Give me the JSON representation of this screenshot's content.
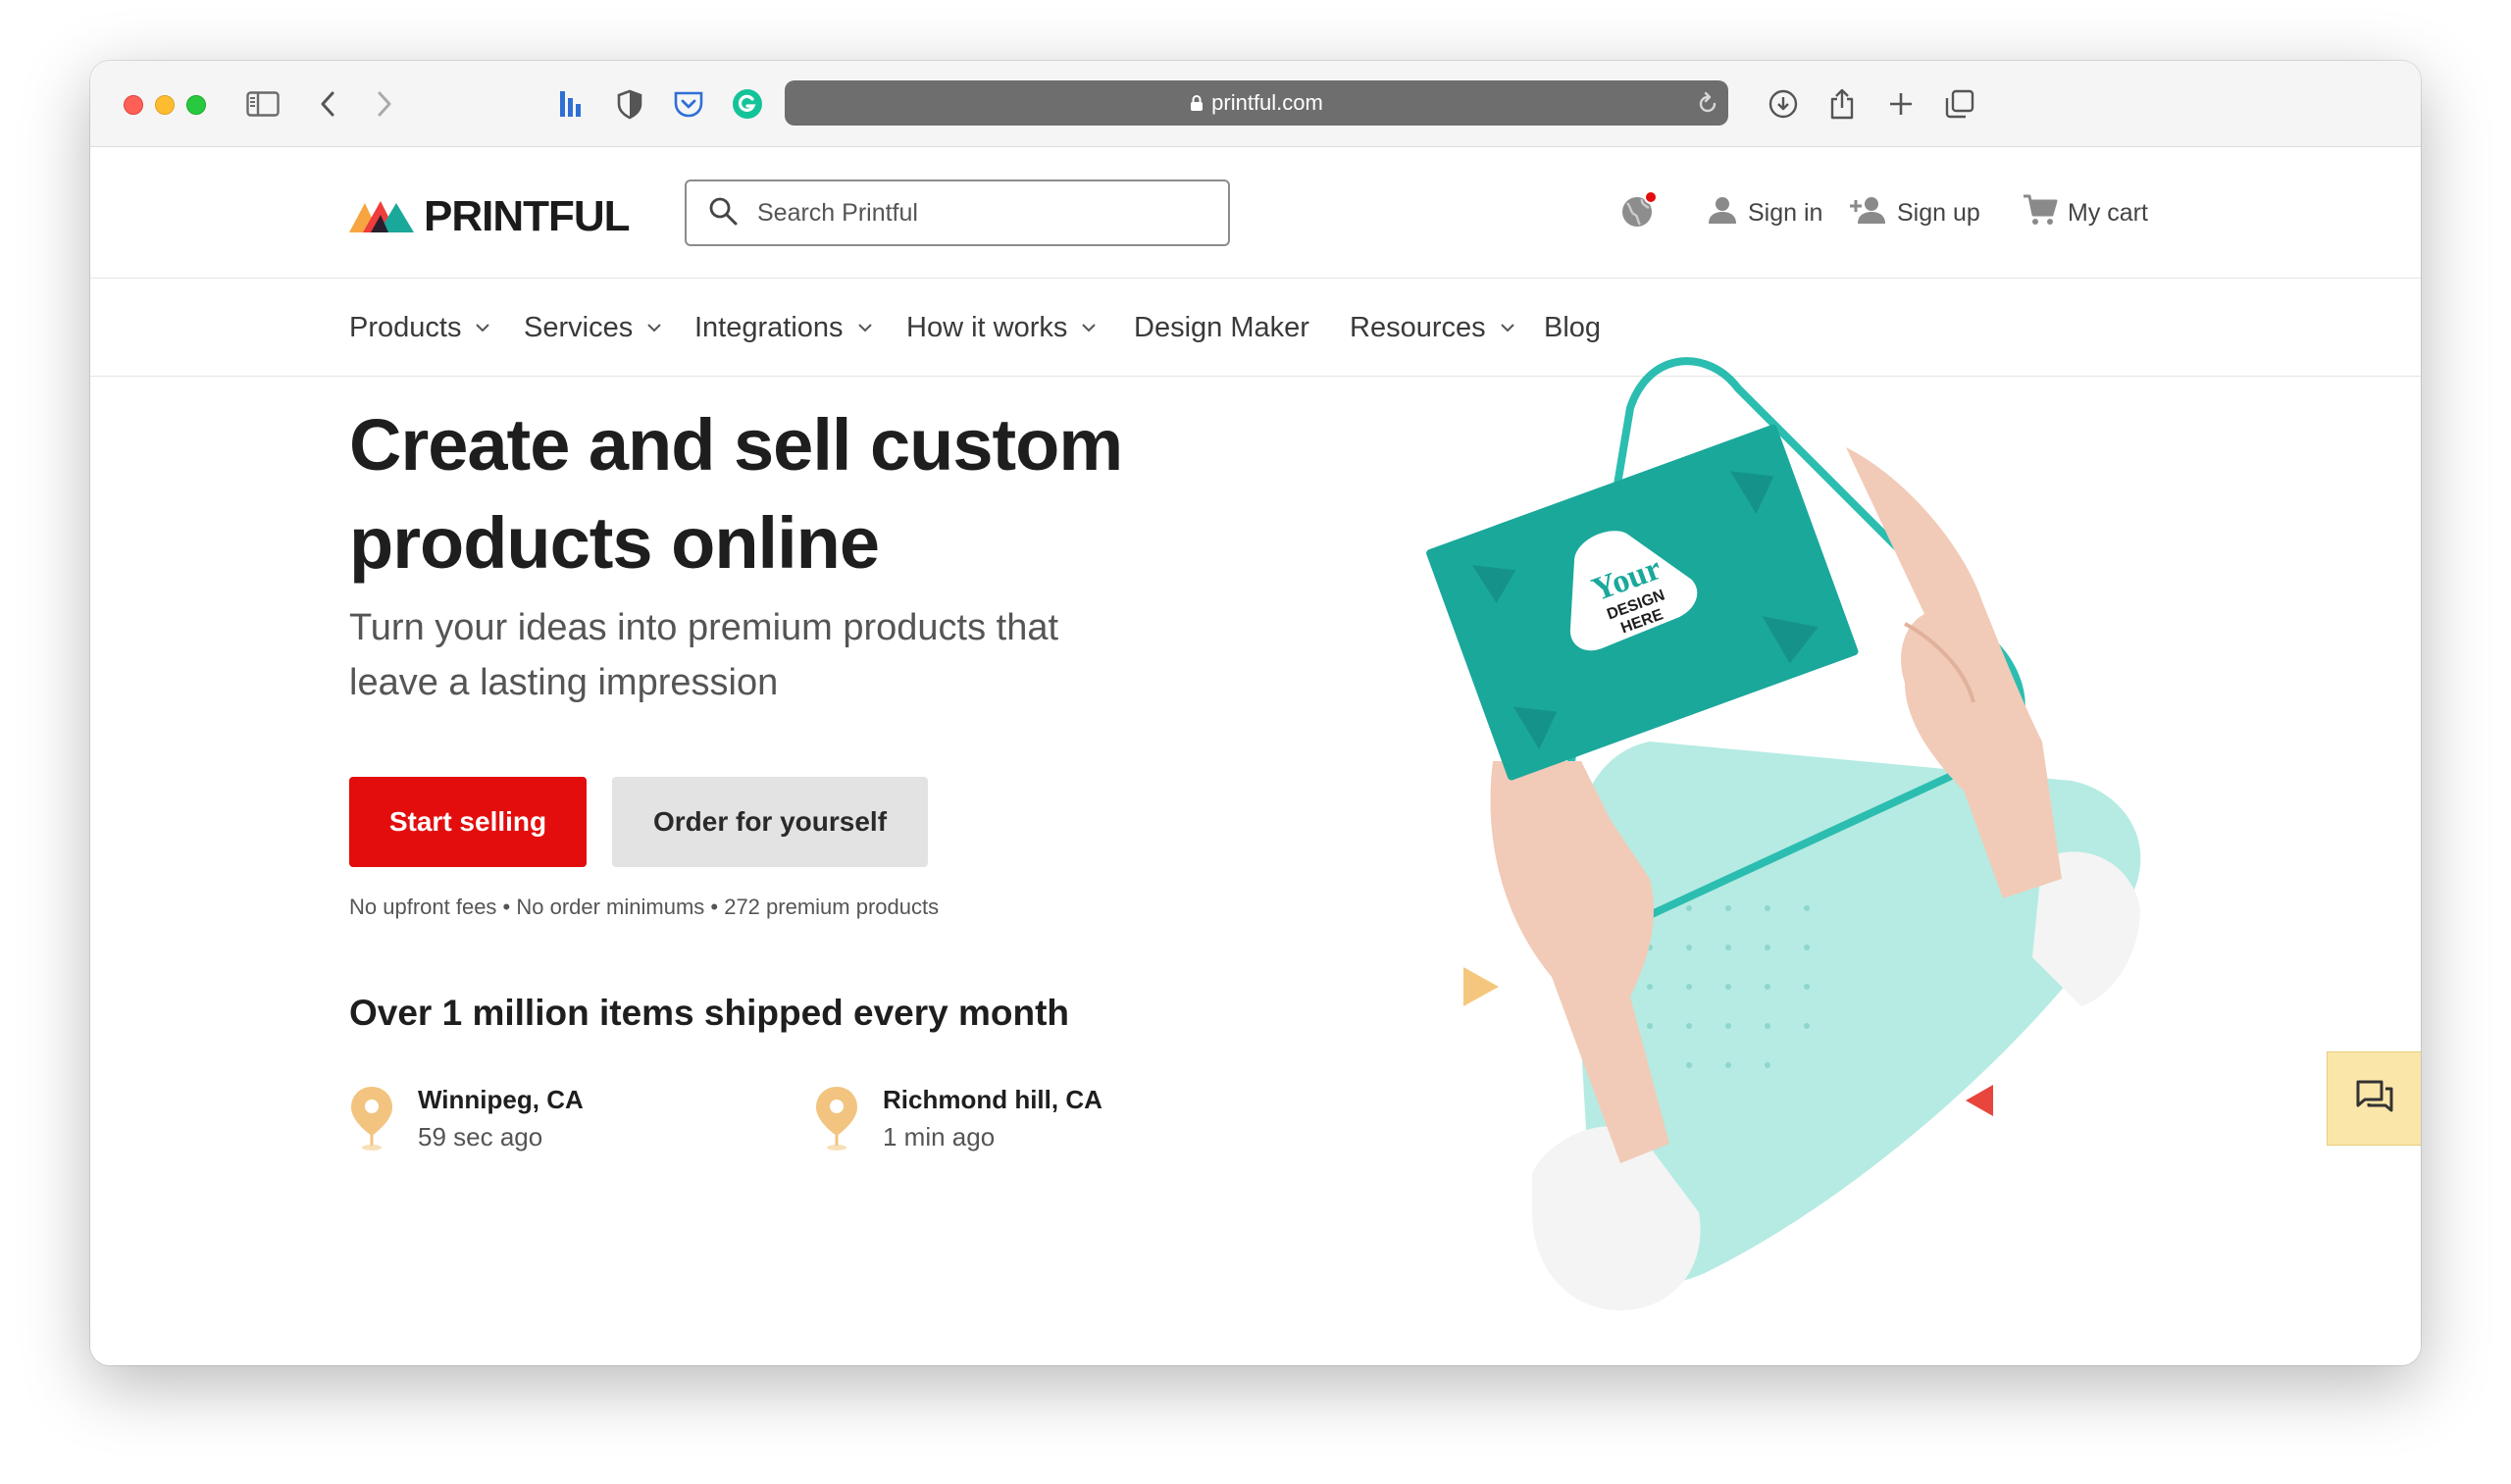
{
  "browser": {
    "url": "printful.com"
  },
  "site": {
    "logo_text": "PRINTFUL",
    "search_placeholder": "Search Printful",
    "header_links": {
      "sign_in": "Sign in",
      "sign_up": "Sign up",
      "cart": "My cart"
    },
    "nav": [
      {
        "label": "Products",
        "has_dropdown": true
      },
      {
        "label": "Services",
        "has_dropdown": true
      },
      {
        "label": "Integrations",
        "has_dropdown": true
      },
      {
        "label": "How it works",
        "has_dropdown": true
      },
      {
        "label": "Design Maker",
        "has_dropdown": false
      },
      {
        "label": "Resources",
        "has_dropdown": true
      },
      {
        "label": "Blog",
        "has_dropdown": false
      }
    ]
  },
  "hero": {
    "title_line1": "Create and sell custom",
    "title_line2": "products online",
    "subtitle_line1": "Turn your ideas into premium products that",
    "subtitle_line2": "leave a lasting impression",
    "primary_button": "Start selling",
    "secondary_button": "Order for yourself",
    "fine_print": "No upfront fees • No order minimums • 272 premium products",
    "shipped_heading": "Over 1 million items shipped every month",
    "recent_orders": [
      {
        "city": "Winnipeg, CA",
        "ago": "59 sec ago"
      },
      {
        "city": "Richmond hill, CA",
        "ago": "1 min ago"
      }
    ],
    "card_text": {
      "line1": "Your",
      "line2": "DESIGN",
      "line3": "HERE"
    }
  },
  "colors": {
    "primary_red": "#e30d0d",
    "teal": "#1aa89b",
    "mint": "#b5ebe3",
    "pin": "#f2c47f",
    "chat_bg": "#fbe6a9"
  }
}
